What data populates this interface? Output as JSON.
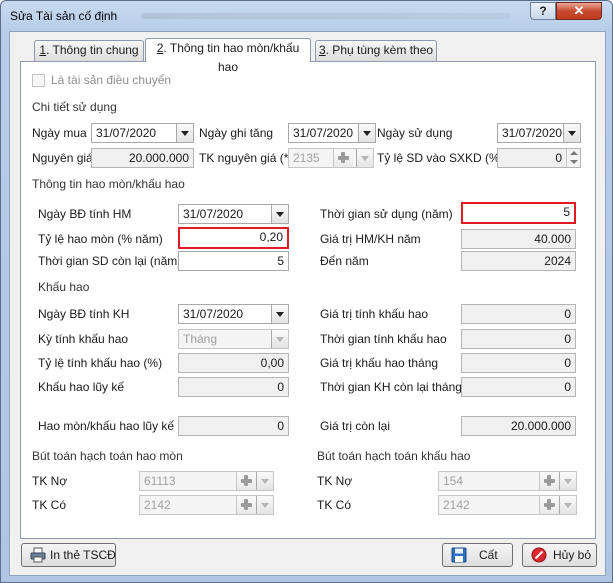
{
  "window": {
    "title": "Sửa Tài sản cố định",
    "help": "?",
    "close": "✕"
  },
  "tabs": [
    {
      "key": "1",
      "label": ". Thông tin chung"
    },
    {
      "key": "2",
      "label": ". Thông tin hao mòn/khấu hao"
    },
    {
      "key": "3",
      "label": ". Phụ tùng kèm theo"
    }
  ],
  "transfer_checkbox": "Là tài sản điều chuyển",
  "usage": {
    "section": "Chi tiết sử dụng",
    "purchase_date_label": "Ngày mua",
    "purchase_date": "31/07/2020",
    "record_date_label": "Ngày ghi tăng",
    "record_date": "31/07/2020",
    "use_date_label": "Ngày sử dụng",
    "use_date": "31/07/2020",
    "cost_label": "Nguyên giá",
    "cost": "20.000.000",
    "cost_account_label": "TK nguyên giá (*)",
    "cost_account": "2135",
    "production_rate_label": "Tỷ lệ SD vào SXKD (%)",
    "production_rate": "0"
  },
  "depreciation_info": {
    "section": "Thông tin hao mòn/khấu hao",
    "start_hm_label": "Ngày BĐ tính HM",
    "start_hm": "31/07/2020",
    "useful_life_label": "Thời gian sử dụng (năm)",
    "useful_life": "5",
    "rate_label": "Tỷ lệ hao mòn (% năm)",
    "rate": "0,20",
    "annual_value_label": "Giá trị HM/KH năm",
    "annual_value": "40.000",
    "remaining_label": "Thời gian SD còn lại (năm)",
    "remaining": "5",
    "end_year_label": "Đến năm",
    "end_year": "2024"
  },
  "amortization": {
    "section": "Khấu hao",
    "start_kh_label": "Ngày BĐ tính KH",
    "start_kh": "31/07/2020",
    "base_value_label": "Giá trị tính khấu hao",
    "base_value": "0",
    "period_label": "Kỳ tính khấu hao",
    "period": "Tháng",
    "kh_time_label": "Thời gian tính khấu hao",
    "kh_time": "0",
    "kh_rate_label": "Tỷ lệ tính khấu hao (%)",
    "kh_rate": "0,00",
    "monthly_value_label": "Giá trị khấu hao tháng",
    "monthly_value": "0",
    "accumulated_label": "Khấu hao lũy kế",
    "accumulated": "0",
    "remaining_months_label": "Thời gian KH còn lại tháng",
    "remaining_months": "0"
  },
  "totals": {
    "accum_label": "Hao mòn/khấu hao lũy kế",
    "accum": "0",
    "residual_label": "Giá trị còn lại",
    "residual": "20.000.000"
  },
  "entries_hm": {
    "section": "Bút toán hạch toán hao mòn",
    "debit_label": "TK Nợ",
    "debit": "61113",
    "credit_label": "TK Có",
    "credit": "2142"
  },
  "entries_kh": {
    "section": "Bút toán hạch toán khấu hao",
    "debit_label": "TK Nợ",
    "debit": "154",
    "credit_label": "TK Có",
    "credit": "2142"
  },
  "buttons": {
    "print": "In thẻ TSCĐ",
    "save": "Cất",
    "cancel": "Hủy bỏ"
  },
  "colors": {
    "highlight_border": "#e01b24",
    "titlebar": "#b7cde8",
    "close": "#c84b30"
  }
}
